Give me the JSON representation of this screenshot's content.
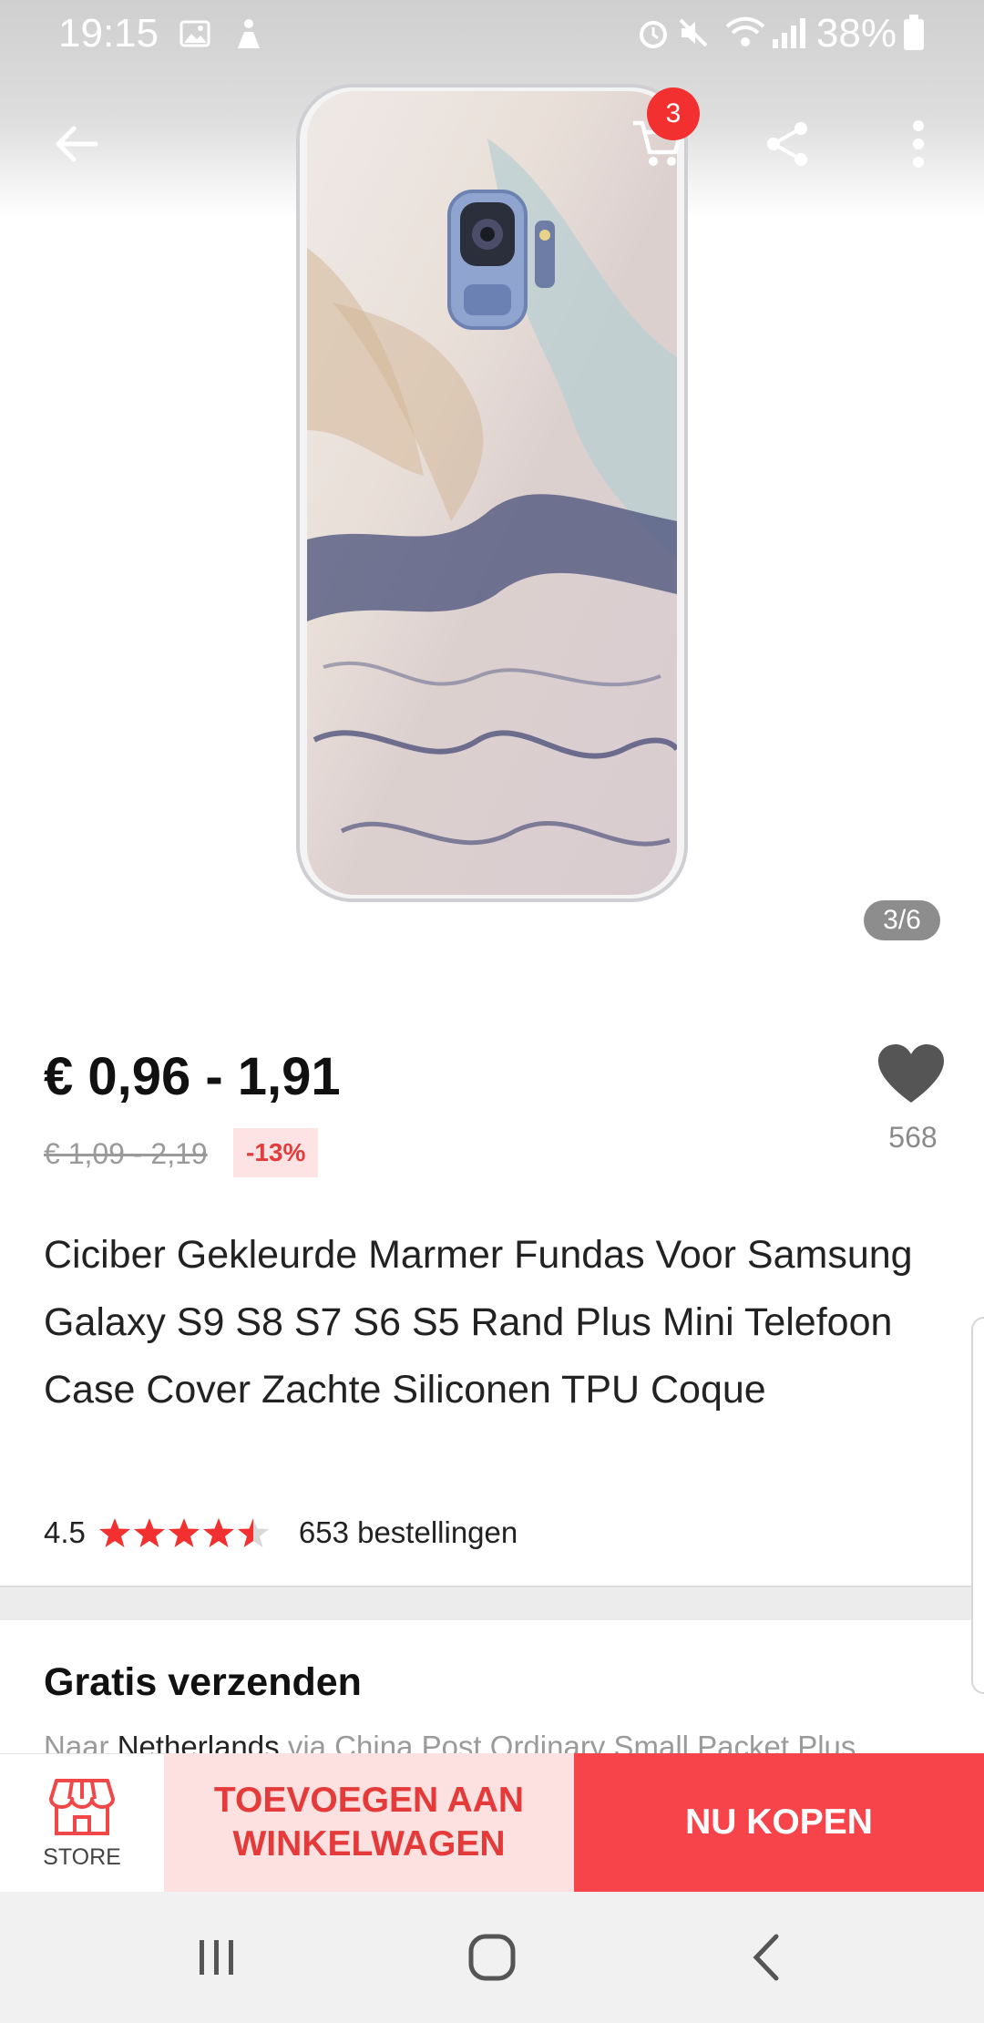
{
  "status_bar": {
    "time": "19:15",
    "battery": "38%",
    "icons": [
      "gallery-icon",
      "accessibility-icon",
      "alarm-icon",
      "mute-icon",
      "wifi-icon",
      "signal-icon",
      "battery-icon"
    ]
  },
  "top_bar": {
    "cart_count": "3",
    "icons": [
      "back-arrow-icon",
      "cart-icon",
      "share-icon",
      "more-vertical-icon"
    ]
  },
  "gallery": {
    "counter": "3/6"
  },
  "product": {
    "price": "€ 0,96 - 1,91",
    "old_price": "€ 1,09 - 2,19",
    "discount": "-13%",
    "wishlist_count": "568",
    "title": "Ciciber Gekleurde Marmer Fundas Voor Samsung Galaxy S9 S8 S7 S6 S5 Rand Plus Mini Telefoon Case Cover Zachte Siliconen TPU Coque",
    "rating": "4.5",
    "rating_stars": 4.5,
    "orders": "653 bestellingen"
  },
  "shipping": {
    "title": "Gratis verzenden",
    "prefix": "Naar",
    "country": "Netherlands",
    "suffix": "via China Post Ordinary Small Packet Plus"
  },
  "actions": {
    "store_label": "STORE",
    "add_to_cart": "TOEVOEGEN AAN WINKELWAGEN",
    "buy_now": "NU KOPEN"
  },
  "colors": {
    "accent": "#f7444a",
    "accent_light": "#fde0e0",
    "discount_bg": "#fde3e3",
    "star": "#f23030"
  }
}
